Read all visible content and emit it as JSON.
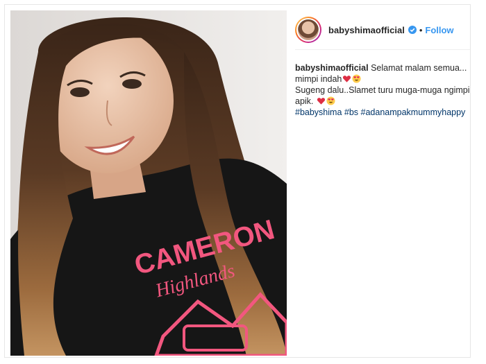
{
  "post": {
    "username": "babyshimaofficial",
    "follow_label": "Follow",
    "dot": "•"
  },
  "caption": {
    "username": "babyshimaofficial",
    "line1": " Selamat malam semua... mimpi indah",
    "line2": "Sugeng dalu..Slamet turu muga-muga ngimpi apik. ",
    "hashtags": [
      "#babyshima",
      "#bs",
      "#adanampakmummyhappy"
    ],
    "emojis": [
      "red-heart",
      "heart-eyes-face"
    ]
  },
  "photo": {
    "shirt_text_line1": "CAMERON",
    "shirt_text_line2": "Highlands"
  },
  "colors": {
    "follow": "#3897f0",
    "hashtag": "#003569",
    "shirt_print": "#f2577f",
    "shirt": "#161616"
  }
}
